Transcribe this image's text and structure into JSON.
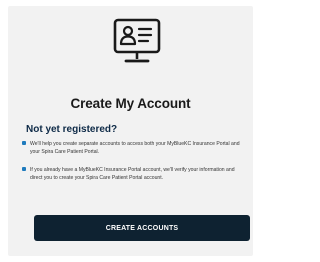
{
  "card": {
    "icon": "computer-profile-icon",
    "title": "Create My Account",
    "subheading": "Not yet registered?",
    "bullets": [
      "We'll help you create separate accounts to access both your MyBlueKC Insurance Portal and your Spira Care Patient Portal.",
      "If you already have a MyBlueKC Insurance Portal account, we'll verify your information and direct you to create your Spira Care Patient Portal account."
    ],
    "cta_label": "CREATE ACCOUNTS"
  },
  "colors": {
    "card_bg": "#f2f2f2",
    "heading_navy": "#0e2a47",
    "bullet_blue": "#1f7bbd",
    "button_bg": "#0e2231"
  }
}
